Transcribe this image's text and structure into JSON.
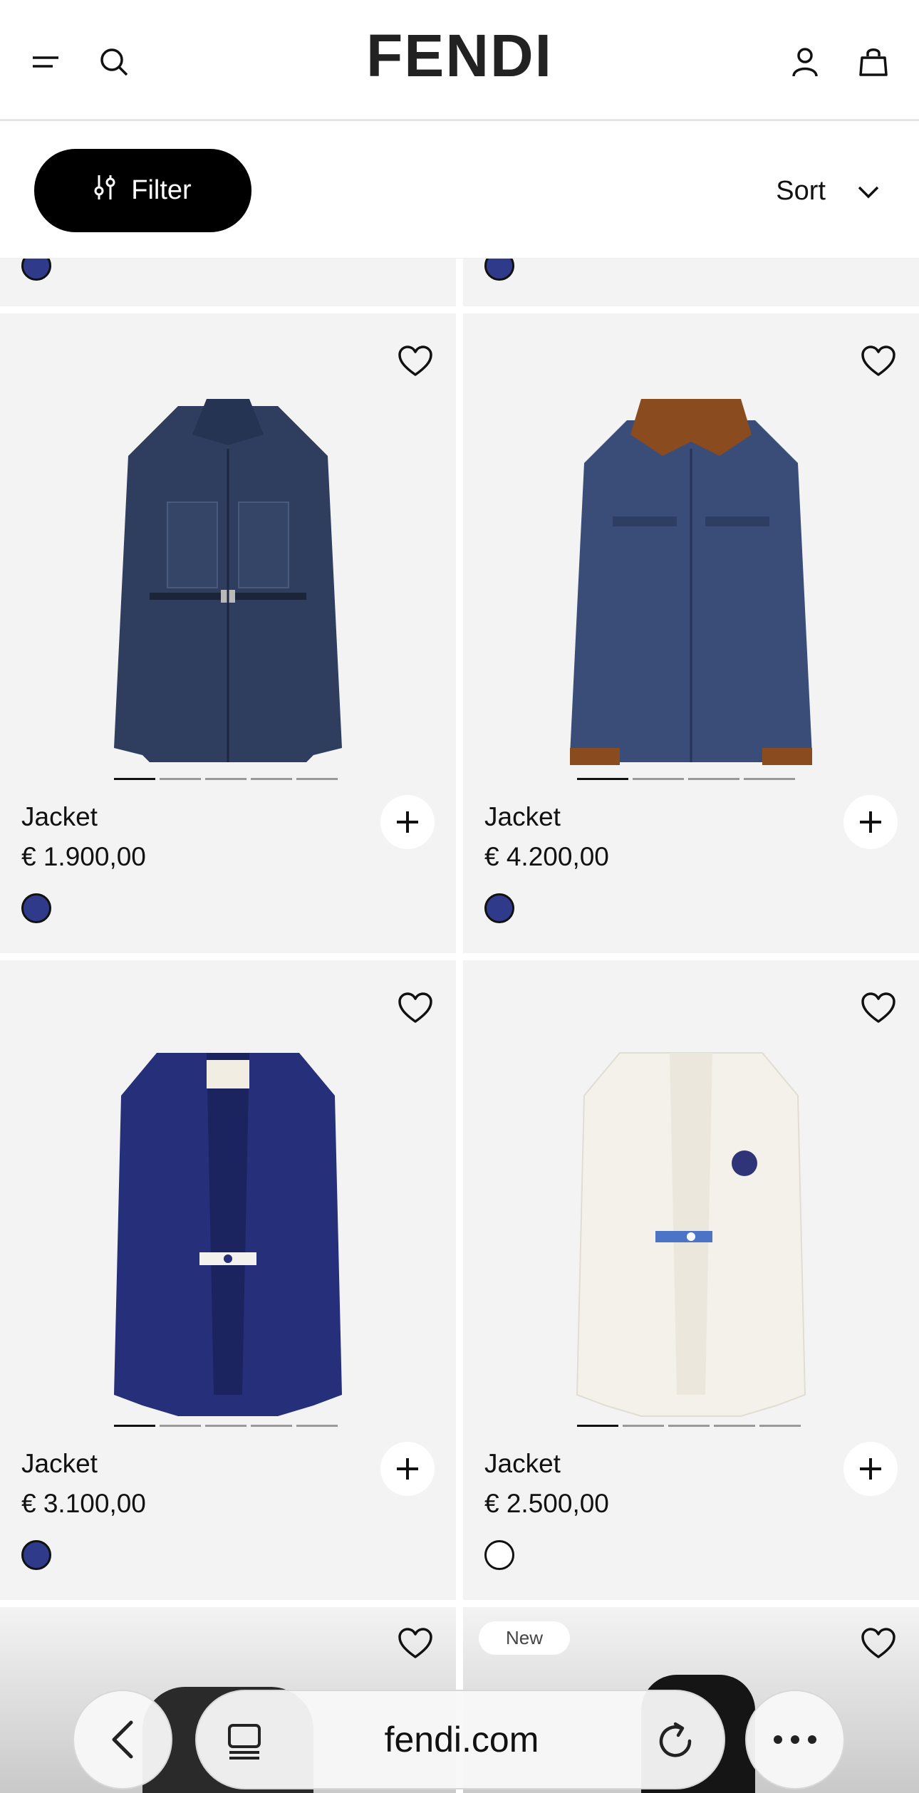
{
  "brand": {
    "logo": "FENDI"
  },
  "toolbar": {
    "filter_label": "Filter",
    "sort_label": "Sort"
  },
  "products": [
    {
      "name": "Jacket",
      "price": "€ 1.900,00",
      "swatch": "#2f3b8a",
      "image": "belted-denim-jacket",
      "new": ""
    },
    {
      "name": "Jacket",
      "price": "€ 4.200,00",
      "swatch": "#2f3b8a",
      "image": "denim-jacket-fur-collar",
      "new": ""
    },
    {
      "name": "Jacket",
      "price": "€ 3.100,00",
      "swatch": "#2f3b8a",
      "image": "navy-blazer",
      "new": ""
    },
    {
      "name": "Jacket",
      "price": "€ 2.500,00",
      "swatch": "#ffffff",
      "image": "white-blazer",
      "new": ""
    },
    {
      "name": "",
      "price": "",
      "swatch": "",
      "image": "",
      "new": ""
    },
    {
      "name": "",
      "price": "",
      "swatch": "",
      "image": "",
      "new": "New"
    }
  ],
  "browser": {
    "url": "fendi.com"
  },
  "colors": {
    "accent": "#000000",
    "tile_bg": "#f3f3f3",
    "swatch_blue": "#2f3b8a"
  }
}
